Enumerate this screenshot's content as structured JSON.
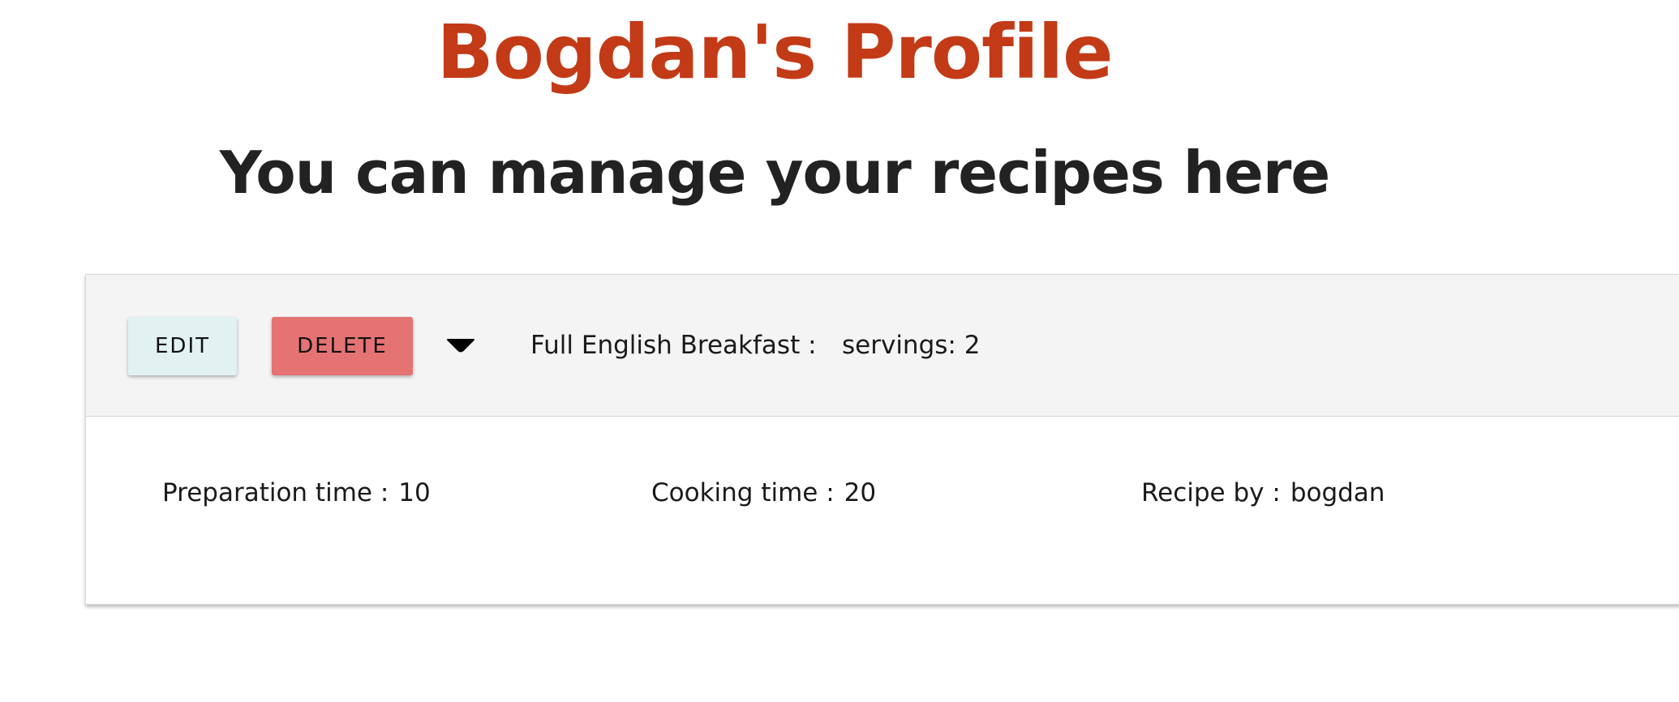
{
  "header": {
    "title": "Bogdan's Profile",
    "subtitle": "You can manage your recipes here"
  },
  "recipe": {
    "edit_label": "EDIT",
    "delete_label": "DELETE",
    "name": "Full English Breakfast :",
    "servings": "servings: 2",
    "prep_label": "Preparation time :",
    "prep_value": "10",
    "cook_label": "Cooking time :",
    "cook_value": "20",
    "author_label": "Recipe by :",
    "author_value": "bogdan"
  },
  "icons": {
    "toggle": "caret-down-icon"
  },
  "colors": {
    "title": "#c33a17",
    "subtitle": "#222222",
    "edit_button_bg": "#e2f1f1",
    "delete_button_bg": "#e57373",
    "card_header_bg": "#f4f4f4"
  }
}
